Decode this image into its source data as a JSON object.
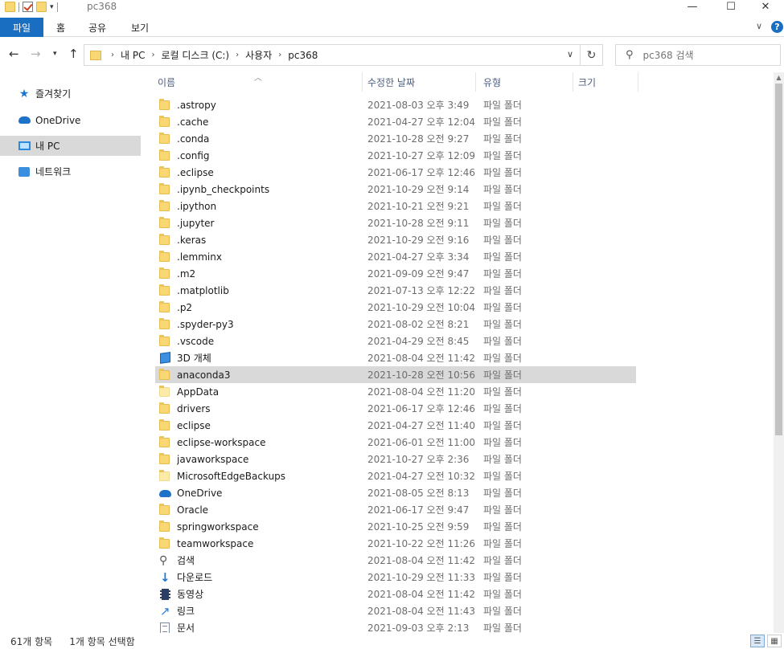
{
  "window": {
    "title": "pc368",
    "controls": {
      "minimize": "—",
      "maximize": "☐",
      "close": "✕"
    }
  },
  "ribbon": {
    "tabs": [
      {
        "label": "파일",
        "active": true
      },
      {
        "label": "홈"
      },
      {
        "label": "공유"
      },
      {
        "label": "보기"
      }
    ],
    "accent": "#1a6ec1",
    "help": "?"
  },
  "address": {
    "crumbs": [
      "내 PC",
      "로컬 디스크 (C:)",
      "사용자",
      "pc368"
    ]
  },
  "search": {
    "placeholder": "pc368 검색"
  },
  "navpane": {
    "items": [
      {
        "label": "즐겨찾기",
        "icon": "star-icon"
      },
      {
        "label": "OneDrive",
        "icon": "onedrive-icon"
      },
      {
        "label": "내 PC",
        "icon": "computer-icon",
        "selected": true
      },
      {
        "label": "네트워크",
        "icon": "network-icon"
      }
    ]
  },
  "columns": {
    "name": "이름",
    "date": "수정한 날짜",
    "type": "유형",
    "size": "크기"
  },
  "files": [
    {
      "name": ".astropy",
      "date": "2021-08-03 오후 3:49",
      "type": "파일 폴더",
      "icon": "folder"
    },
    {
      "name": ".cache",
      "date": "2021-04-27 오후 12:04",
      "type": "파일 폴더",
      "icon": "folder"
    },
    {
      "name": ".conda",
      "date": "2021-10-28 오전 9:27",
      "type": "파일 폴더",
      "icon": "folder"
    },
    {
      "name": ".config",
      "date": "2021-10-27 오후 12:09",
      "type": "파일 폴더",
      "icon": "folder"
    },
    {
      "name": ".eclipse",
      "date": "2021-06-17 오후 12:46",
      "type": "파일 폴더",
      "icon": "folder"
    },
    {
      "name": ".ipynb_checkpoints",
      "date": "2021-10-29 오전 9:14",
      "type": "파일 폴더",
      "icon": "folder"
    },
    {
      "name": ".ipython",
      "date": "2021-10-21 오전 9:21",
      "type": "파일 폴더",
      "icon": "folder"
    },
    {
      "name": ".jupyter",
      "date": "2021-10-28 오전 9:11",
      "type": "파일 폴더",
      "icon": "folder"
    },
    {
      "name": ".keras",
      "date": "2021-10-29 오전 9:16",
      "type": "파일 폴더",
      "icon": "folder"
    },
    {
      "name": ".lemminx",
      "date": "2021-04-27 오후 3:34",
      "type": "파일 폴더",
      "icon": "folder"
    },
    {
      "name": ".m2",
      "date": "2021-09-09 오전 9:47",
      "type": "파일 폴더",
      "icon": "folder"
    },
    {
      "name": ".matplotlib",
      "date": "2021-07-13 오후 12:22",
      "type": "파일 폴더",
      "icon": "folder"
    },
    {
      "name": ".p2",
      "date": "2021-10-29 오전 10:04",
      "type": "파일 폴더",
      "icon": "folder"
    },
    {
      "name": ".spyder-py3",
      "date": "2021-08-02 오전 8:21",
      "type": "파일 폴더",
      "icon": "folder"
    },
    {
      "name": ".vscode",
      "date": "2021-04-29 오전 8:45",
      "type": "파일 폴더",
      "icon": "folder"
    },
    {
      "name": "3D 개체",
      "date": "2021-08-04 오전 11:42",
      "type": "파일 폴더",
      "icon": "cube"
    },
    {
      "name": "anaconda3",
      "date": "2021-10-28 오전 10:56",
      "type": "파일 폴더",
      "icon": "folder",
      "selected": true
    },
    {
      "name": "AppData",
      "date": "2021-08-04 오전 11:20",
      "type": "파일 폴더",
      "icon": "folder-pale"
    },
    {
      "name": "drivers",
      "date": "2021-06-17 오후 12:46",
      "type": "파일 폴더",
      "icon": "folder"
    },
    {
      "name": "eclipse",
      "date": "2021-04-27 오전 11:40",
      "type": "파일 폴더",
      "icon": "folder"
    },
    {
      "name": "eclipse-workspace",
      "date": "2021-06-01 오전 11:00",
      "type": "파일 폴더",
      "icon": "folder"
    },
    {
      "name": "javaworkspace",
      "date": "2021-10-27 오후 2:36",
      "type": "파일 폴더",
      "icon": "folder"
    },
    {
      "name": "MicrosoftEdgeBackups",
      "date": "2021-04-27 오전 10:32",
      "type": "파일 폴더",
      "icon": "folder-pale"
    },
    {
      "name": "OneDrive",
      "date": "2021-08-05 오전 8:13",
      "type": "파일 폴더",
      "icon": "cloud"
    },
    {
      "name": "Oracle",
      "date": "2021-06-17 오전 9:47",
      "type": "파일 폴더",
      "icon": "folder"
    },
    {
      "name": "springworkspace",
      "date": "2021-10-25 오전 9:59",
      "type": "파일 폴더",
      "icon": "folder"
    },
    {
      "name": "teamworkspace",
      "date": "2021-10-22 오전 11:26",
      "type": "파일 폴더",
      "icon": "folder"
    },
    {
      "name": "검색",
      "date": "2021-08-04 오전 11:42",
      "type": "파일 폴더",
      "icon": "search"
    },
    {
      "name": "다운로드",
      "date": "2021-10-29 오전 11:33",
      "type": "파일 폴더",
      "icon": "download"
    },
    {
      "name": "동영상",
      "date": "2021-08-04 오전 11:42",
      "type": "파일 폴더",
      "icon": "video"
    },
    {
      "name": "링크",
      "date": "2021-08-04 오전 11:43",
      "type": "파일 폴더",
      "icon": "link"
    },
    {
      "name": "문서",
      "date": "2021-09-03 오후 2:13",
      "type": "파일 폴더",
      "icon": "document"
    }
  ],
  "status": {
    "count": "61개 항목",
    "selection": "1개 항목 선택함"
  }
}
